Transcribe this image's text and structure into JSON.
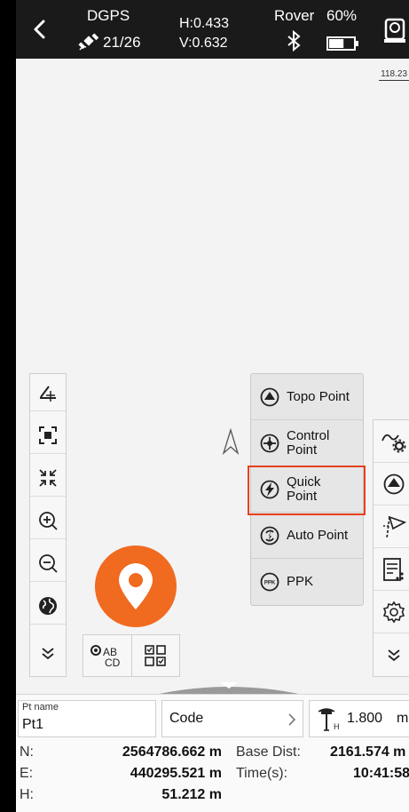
{
  "statusbar": {
    "solution": "DGPS",
    "satellites": "21/26",
    "h_precision": "H:0.433",
    "v_precision": "V:0.632",
    "mode": "Rover",
    "battery": "60%",
    "battery_level": 0.6
  },
  "map": {
    "scale_label": "118.23"
  },
  "left_toolbar": {
    "items": [
      "measure-icon",
      "fit-extent-icon",
      "zoom-fit-icon",
      "zoom-in-icon",
      "zoom-out-icon",
      "globe-icon",
      "expand-down-icon"
    ]
  },
  "label_buttons": {
    "label_toggle": "AB CD"
  },
  "point_menu": {
    "items": [
      {
        "label": "Topo Point"
      },
      {
        "label": "Control Point",
        "line1": "Control",
        "line2": "Point"
      },
      {
        "label": "Quick Point",
        "line1": "Quick",
        "line2": "Point",
        "highlighted": true
      },
      {
        "label": "Auto Point"
      },
      {
        "label": "PPK"
      }
    ]
  },
  "right_toolbar": {
    "items": [
      "line-settings-icon",
      "survey-icon",
      "stakeout-icon",
      "point-list-icon",
      "settings-icon",
      "expand-down-icon"
    ]
  },
  "bottom": {
    "pt_name_label": "Pt name",
    "pt_name_value": "Pt1",
    "code_value": "Code",
    "antenna_height": "1.800",
    "antenna_unit": "m",
    "N_label": "N:",
    "N_value": "2564786.662 m",
    "E_label": "E:",
    "E_value": "440295.521 m",
    "H_label": "H:",
    "H_value": "51.212 m",
    "base_dist_label": "Base Dist:",
    "base_dist_value": "2161.574 m",
    "time_label": "Time(s):",
    "time_value": "10:41:58"
  },
  "colors": {
    "accent": "#f06a1f",
    "highlight": "#e5401f"
  }
}
